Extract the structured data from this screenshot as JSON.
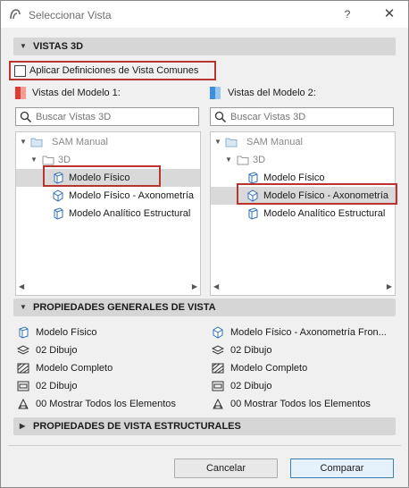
{
  "window": {
    "title": "Seleccionar Vista",
    "help_label": "?",
    "close_label": "✕"
  },
  "sections": {
    "views3d": "VISTAS 3D",
    "general_props": "PROPIEDADES GENERALES DE VISTA",
    "structural_props": "PROPIEDADES DE VISTA ESTRUCTURALES"
  },
  "apply_common": {
    "label": "Aplicar Definiciones de Vista Comunes",
    "checked": false
  },
  "model1": {
    "label": "Vistas del Modelo 1:",
    "color": "#e03a34",
    "search_placeholder": "Buscar Vistas 3D",
    "tree": {
      "root": "SAM Manual",
      "folder": "3D",
      "items": [
        "Modelo Físico",
        "Modelo Físico - Axonometría",
        "Modelo Analítico Estructural"
      ],
      "selected": 0
    }
  },
  "model2": {
    "label": "Vistas del Modelo 2:",
    "color": "#3a8fe0",
    "search_placeholder": "Buscar Vistas 3D",
    "tree": {
      "root": "SAM Manual",
      "folder": "3D",
      "items": [
        "Modelo Físico",
        "Modelo Físico - Axonometría",
        "Modelo Analítico Estructural"
      ],
      "selected": 1
    }
  },
  "properties": {
    "left": [
      "Modelo Físico",
      "02 Dibujo",
      "Modelo Completo",
      "02 Dibujo",
      "00 Mostrar Todos los Elementos"
    ],
    "right": [
      "Modelo Físico - Axonometría Fron...",
      "02 Dibujo",
      "Modelo Completo",
      "02 Dibujo",
      "00 Mostrar Todos los Elementos"
    ]
  },
  "buttons": {
    "cancel": "Cancelar",
    "compare": "Comparar"
  },
  "accent": "#b9342f"
}
